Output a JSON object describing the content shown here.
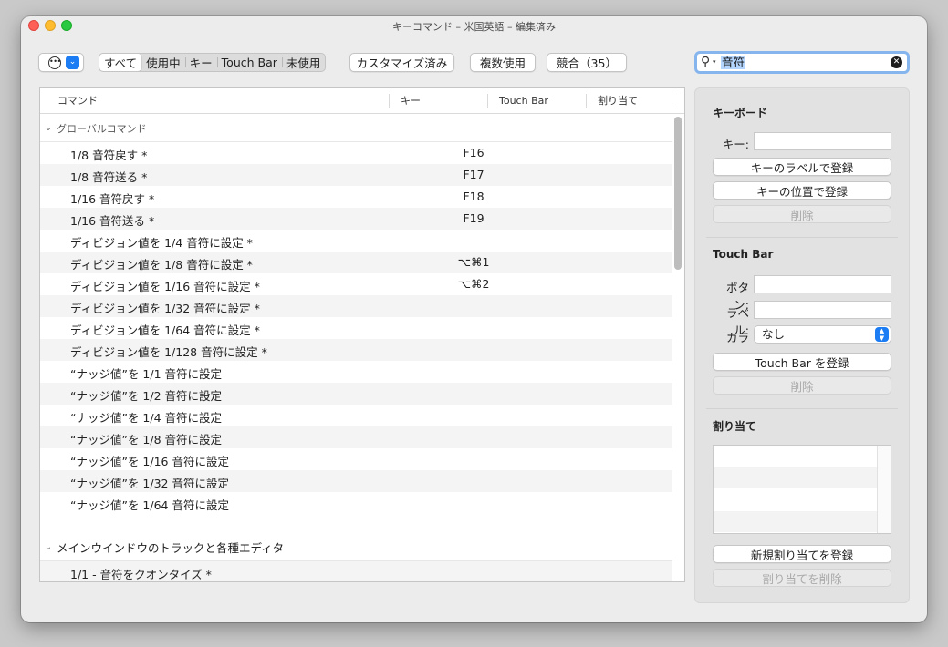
{
  "window": {
    "title": "キーコマンド – 米国英語 – 編集済み"
  },
  "toolbar": {
    "filters": [
      "すべて",
      "使用中",
      "キー",
      "Touch Bar",
      "未使用"
    ],
    "customized_label": "カスタマイズ済み",
    "multiple_label": "複数使用",
    "conflicts_label": "競合（35）"
  },
  "search": {
    "value": "音符"
  },
  "table": {
    "headers": {
      "command": "コマンド",
      "key": "キー",
      "touch_bar": "Touch Bar",
      "assignment": "割り当て"
    },
    "groups": [
      {
        "name": "グローバルコマンド",
        "rows": [
          {
            "command": "1/8 音符戻す *",
            "key": "F16"
          },
          {
            "command": "1/8 音符送る *",
            "key": "F17"
          },
          {
            "command": "1/16 音符戻す *",
            "key": "F18"
          },
          {
            "command": "1/16 音符送る *",
            "key": "F19"
          },
          {
            "command": "ディビジョン値を 1/4 音符に設定 *",
            "key": ""
          },
          {
            "command": "ディビジョン値を 1/8 音符に設定 *",
            "key": "⌥⌘1"
          },
          {
            "command": "ディビジョン値を 1/16 音符に設定 *",
            "key": "⌥⌘2"
          },
          {
            "command": "ディビジョン値を 1/32 音符に設定 *",
            "key": ""
          },
          {
            "command": "ディビジョン値を 1/64 音符に設定 *",
            "key": ""
          },
          {
            "command": "ディビジョン値を 1/128 音符に設定 *",
            "key": ""
          },
          {
            "command": "“ナッジ値”を 1/1 音符に設定",
            "key": ""
          },
          {
            "command": "“ナッジ値”を 1/2 音符に設定",
            "key": ""
          },
          {
            "command": "“ナッジ値”を 1/4 音符に設定",
            "key": ""
          },
          {
            "command": "“ナッジ値”を 1/8 音符に設定",
            "key": ""
          },
          {
            "command": "“ナッジ値”を 1/16 音符に設定",
            "key": ""
          },
          {
            "command": "“ナッジ値”を 1/32 音符に設定",
            "key": ""
          },
          {
            "command": "“ナッジ値”を 1/64 音符に設定",
            "key": ""
          }
        ]
      },
      {
        "name": "メインウインドウのトラックと各種エディタ",
        "rows": [
          {
            "command": "1/1 - 音符をクオンタイズ *",
            "key": ""
          }
        ]
      }
    ]
  },
  "panel": {
    "keyboard": {
      "title": "キーボード",
      "key_label": "キー:",
      "assign_by_label": "キーのラベルで登録",
      "assign_by_position": "キーの位置で登録",
      "delete": "削除"
    },
    "touch_bar": {
      "title": "Touch Bar",
      "button_label": "ボタン:",
      "label_label": "ラベル:",
      "color_label": "カラー:",
      "color_value": "なし",
      "assign": "Touch Bar を登録",
      "delete": "削除"
    },
    "assignments": {
      "title": "割り当て",
      "new": "新規割り当てを登録",
      "delete": "割り当てを削除"
    }
  },
  "colors": {
    "accent": "#1c7cf4",
    "search_focus": "#86b5ee",
    "selection": "#b3d4fc"
  }
}
